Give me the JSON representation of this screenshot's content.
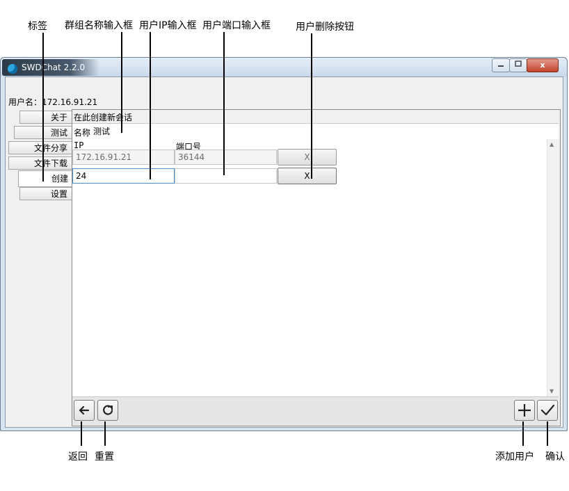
{
  "annotations": {
    "tab": "标签",
    "group_name_input": "群组名称输入框",
    "user_ip_input": "用户IP输入框",
    "user_port_input": "用户端口输入框",
    "user_delete_button": "用户删除按钮",
    "back": "返回",
    "reset": "重置",
    "add_user": "添加用户",
    "confirm": "确认"
  },
  "window": {
    "title": "SWDChat 2.2.0",
    "controls": {
      "close": "x"
    }
  },
  "user_label": "用户名：172.16.91.21",
  "tabs": [
    {
      "label": "关于",
      "active": false
    },
    {
      "label": "测试",
      "active": false
    },
    {
      "label": "文件分享",
      "active": false
    },
    {
      "label": "文件下载",
      "active": false
    },
    {
      "label": "创建",
      "active": true
    },
    {
      "label": "设置",
      "active": false
    }
  ],
  "create_panel": {
    "header": "在此创建新会话",
    "name_label": "名称",
    "name_value": "测试",
    "columns": {
      "ip": "IP",
      "port": "端口号"
    },
    "rows": [
      {
        "ip": "172.16.91.21",
        "port": "36144",
        "delete": "X",
        "editable": false
      },
      {
        "ip": "24",
        "port": "",
        "delete": "X",
        "editable": true
      }
    ]
  },
  "bottom_buttons": {
    "back_icon": "arrow-left-icon",
    "reset_icon": "refresh-icon",
    "add_icon": "plus-icon",
    "confirm_icon": "check-icon"
  }
}
